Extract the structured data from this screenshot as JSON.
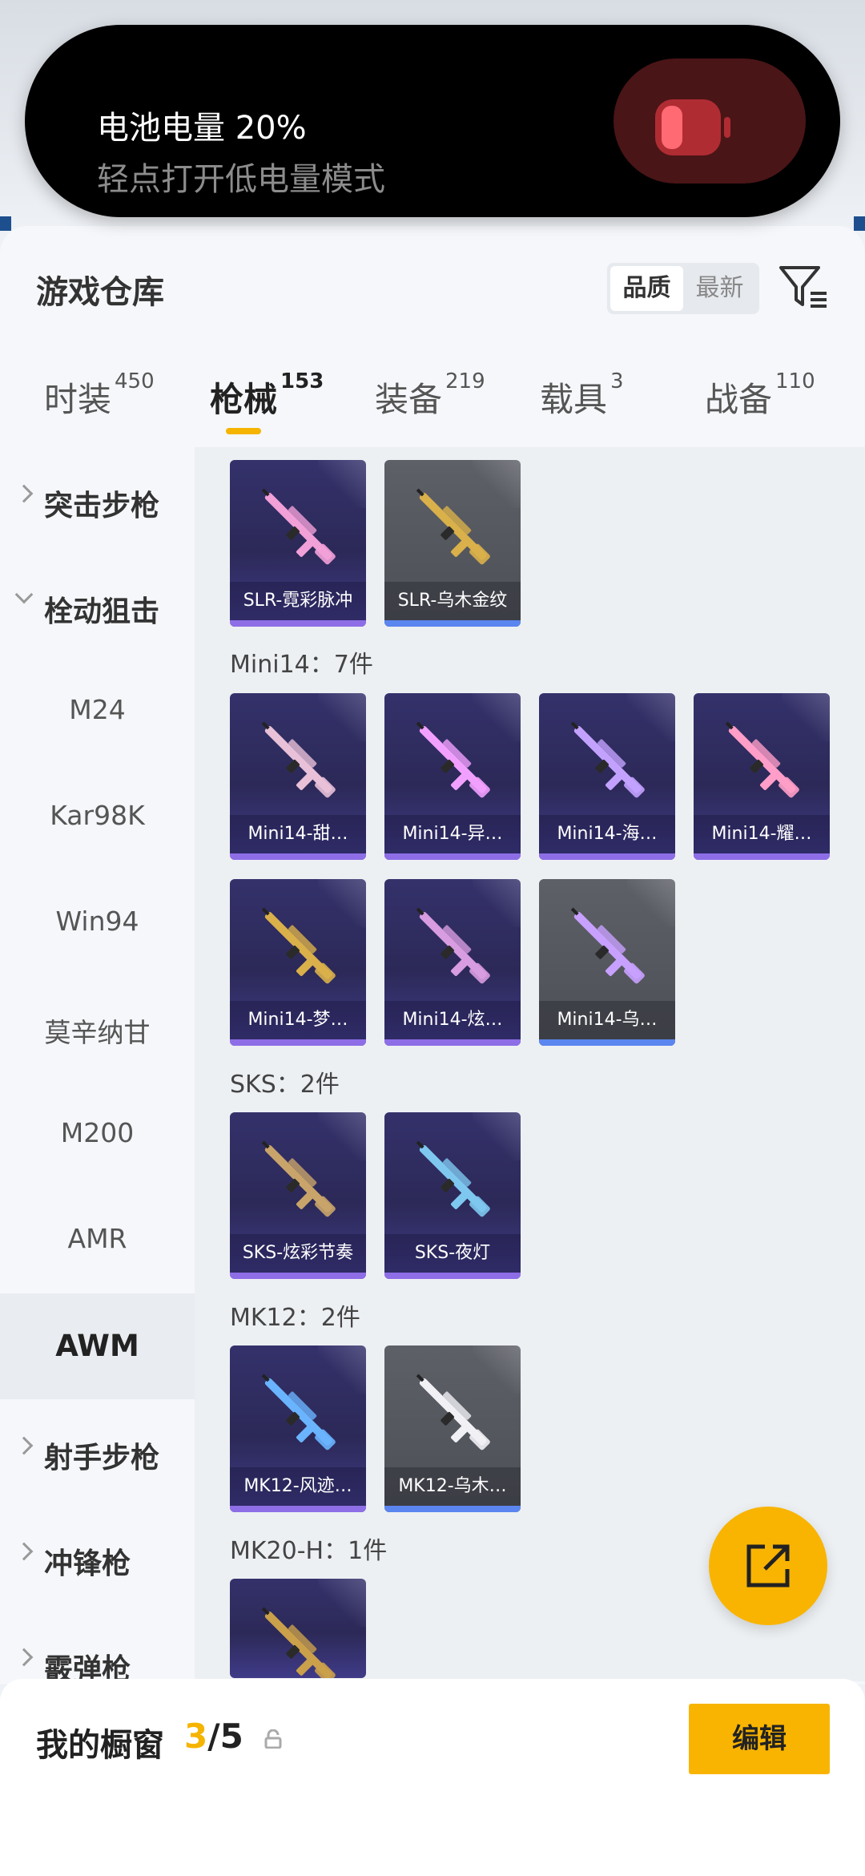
{
  "system_banner": {
    "title": "电池电量 20%",
    "subtitle": "轻点打开低电量模式"
  },
  "header": {
    "title": "游戏仓库",
    "sort_options": [
      "品质",
      "最新"
    ],
    "sort_active": "品质"
  },
  "tabs": [
    {
      "label": "时装",
      "count": "450"
    },
    {
      "label": "枪械",
      "count": "153"
    },
    {
      "label": "装备",
      "count": "219"
    },
    {
      "label": "载具",
      "count": "3"
    },
    {
      "label": "战备",
      "count": "110"
    }
  ],
  "active_tab": "枪械",
  "sidebar": {
    "items": [
      {
        "label": "突击步枪",
        "type": "category",
        "expanded": false
      },
      {
        "label": "栓动狙击",
        "type": "category",
        "expanded": true
      },
      {
        "label": "M24",
        "type": "sub"
      },
      {
        "label": "Kar98K",
        "type": "sub"
      },
      {
        "label": "Win94",
        "type": "sub"
      },
      {
        "label": "莫辛纳甘",
        "type": "sub"
      },
      {
        "label": "M200",
        "type": "sub"
      },
      {
        "label": "AMR",
        "type": "sub"
      },
      {
        "label": "AWM",
        "type": "sub",
        "active": true
      },
      {
        "label": "射手步枪",
        "type": "category",
        "expanded": false
      },
      {
        "label": "冲锋枪",
        "type": "category",
        "expanded": false
      },
      {
        "label": "霰弹枪",
        "type": "category",
        "expanded": false
      }
    ]
  },
  "groups": [
    {
      "label": "",
      "items": [
        {
          "name": "SLR-霓彩脉冲",
          "tier": "purple"
        },
        {
          "name": "SLR-乌木金纹",
          "tier": "grey"
        }
      ]
    },
    {
      "label": "Mini14：7件",
      "items": [
        {
          "name": "Mini14-甜…",
          "tier": "purple"
        },
        {
          "name": "Mini14-异…",
          "tier": "purple"
        },
        {
          "name": "Mini14-海…",
          "tier": "purple"
        },
        {
          "name": "Mini14-耀…",
          "tier": "purple"
        },
        {
          "name": "Mini14-梦…",
          "tier": "purple"
        },
        {
          "name": "Mini14-炫…",
          "tier": "purple"
        },
        {
          "name": "Mini14-乌…",
          "tier": "grey"
        }
      ]
    },
    {
      "label": "SKS：2件",
      "items": [
        {
          "name": "SKS-炫彩节奏",
          "tier": "purple"
        },
        {
          "name": "SKS-夜灯",
          "tier": "purple"
        }
      ]
    },
    {
      "label": "MK12：2件",
      "items": [
        {
          "name": "MK12-风迹…",
          "tier": "purple"
        },
        {
          "name": "MK12-乌木…",
          "tier": "grey"
        }
      ]
    },
    {
      "label": "MK20-H：1件",
      "items": [
        {
          "name": "",
          "tier": "purple"
        }
      ]
    }
  ],
  "showcase": {
    "label": "我的橱窗",
    "current": "3",
    "total": "/5",
    "edit_label": "编辑"
  },
  "colors": {
    "accent": "#f8b400",
    "card_purple": "#2c2958",
    "card_grey": "#4d4f56",
    "battery_red": "#ff6a73"
  }
}
